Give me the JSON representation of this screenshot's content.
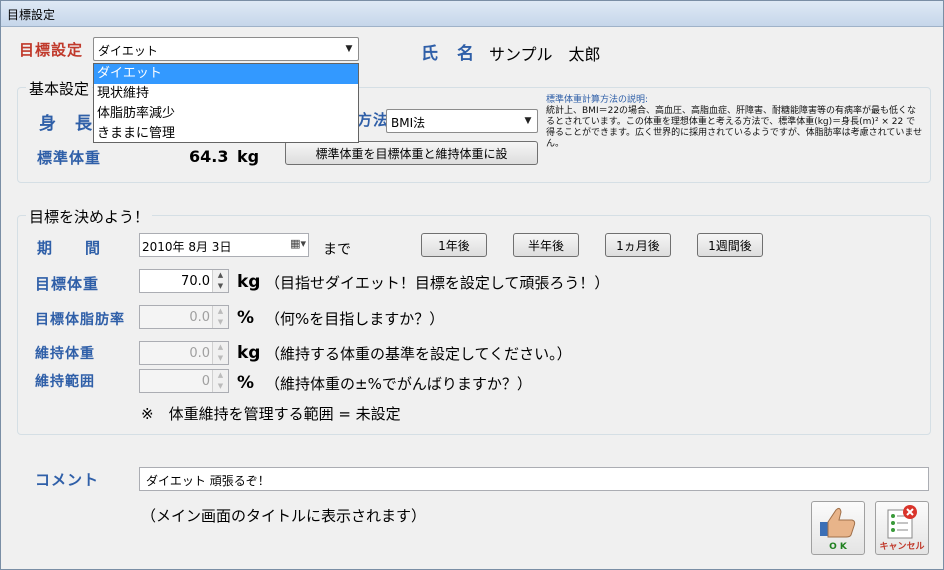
{
  "window": {
    "title": "目標設定"
  },
  "header": {
    "goal_label": "目標設定",
    "goal_selected": "ダイエット",
    "goal_options": [
      "ダイエット",
      "現状維持",
      "体脂肪率減少",
      "きままに管理"
    ],
    "name_label": "氏　名",
    "name_value": "サンプル　太郎"
  },
  "basic": {
    "legend": "基本設定",
    "height_label": "身　長",
    "std_weight_label": "標準体重",
    "std_weight_value": "64.3",
    "std_weight_unit": "kg",
    "method_label": "方法",
    "method_value": "BMI法",
    "apply_button": "標準体重を目標体重と維持体重に設",
    "desc_title": "標準体重計算方法の説明:",
    "desc_text": "統計上、BMI＝22の場合、高血圧、高脂血症、肝障害、耐糖能障害等の有病率が最も低くなるとされています。この体重を理想体重と考える方法で、標準体重(kg)＝身長(m)² × 22 で得ることができます。広く世界的に採用されているようですが、体脂肪率は考慮されていません。"
  },
  "goals": {
    "legend": "目標を決めよう！",
    "period_label": "期　　間",
    "period_value": "2010年  8月  3日",
    "period_suffix": "まで",
    "btn_1year": "1年後",
    "btn_half": "半年後",
    "btn_1month": "1ヵ月後",
    "btn_1week": "1週間後",
    "target_weight_label": "目標体重",
    "target_weight_value": "70.0",
    "target_weight_unit": "kg",
    "target_weight_hint": "（目指せダイエット！目標を設定して頑張ろう！）",
    "target_fat_label": "目標体脂肪率",
    "target_fat_value": "0.0",
    "target_fat_unit": "%",
    "target_fat_hint": "（何%を目指しますか？）",
    "keep_weight_label": "維持体重",
    "keep_weight_value": "0.0",
    "keep_weight_unit": "kg",
    "keep_weight_hint": "（維持する体重の基準を設定してください。）",
    "keep_range_label": "維持範囲",
    "keep_range_value": "0",
    "keep_range_unit": "%",
    "keep_range_hint": "（維持体重の±%でがんばりますか？）",
    "note": "※　体重維持を管理する範囲 = 未設定"
  },
  "comment": {
    "label": "コメント",
    "value": "ダイエット 頑張るぞ！",
    "note": "（メイン画面のタイトルに表示されます）"
  },
  "actions": {
    "ok_label": "O K",
    "cancel_label": "キャンセル"
  }
}
